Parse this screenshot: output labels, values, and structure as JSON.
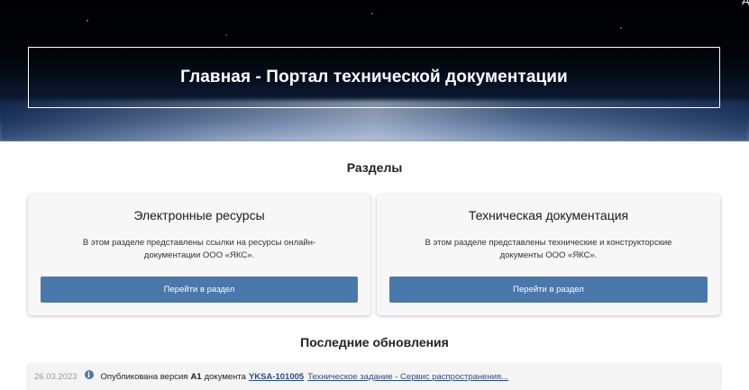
{
  "corner": {
    "text": "Д"
  },
  "hero": {
    "title": "Главная - Портал технической документации"
  },
  "sections": {
    "title": "Разделы",
    "cards": [
      {
        "title": "Электронные ресурсы",
        "description": "В этом разделе представлены ссылки на ресурсы онлайн-документации ООО «ЯКС».",
        "button_label": "Перейти в раздел"
      },
      {
        "title": "Техническая документация",
        "description": "В этом разделе представлены технические и конструкторские документы ООО «ЯКС».",
        "button_label": "Перейти в раздел"
      }
    ]
  },
  "updates": {
    "title": "Последние обновления",
    "items": [
      {
        "date": "26.03.2023",
        "icon": "info-icon",
        "text": "Опубликована версия",
        "version": "А1",
        "doc_word": "документа",
        "doc_code": "YKSA-101005",
        "doc_title": "Техническое задание - Сервис распространения..."
      }
    ]
  },
  "colors": {
    "accent": "#4b78aa",
    "link": "#2a4f86",
    "card_bg": "#f7f7f7"
  }
}
